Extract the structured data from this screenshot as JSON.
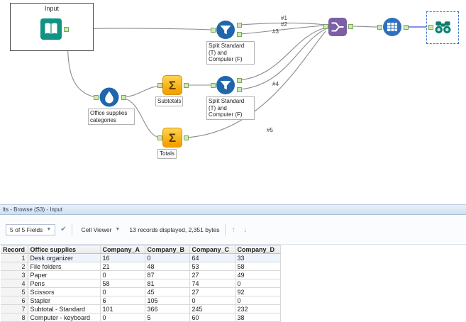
{
  "canvas": {
    "input_container": {
      "label": "Input"
    },
    "tool_labels": {
      "formula": "Office supplies categories",
      "subtotals": "Subtotals",
      "totals": "Totals",
      "filter_top": "Split Standard (T) and Computer (F)",
      "filter_bottom": "Split Standard (T) and Computer (F)"
    },
    "wire_labels": {
      "w1": "#1",
      "w2": "#2",
      "w3": "#3",
      "w4": "#4",
      "w5": "#5"
    },
    "summarize_glyph": "Σ",
    "colors": {
      "input_teal": "#0e9384",
      "tool_blue": "#1f66ad",
      "summarize_orange": "#f5a200",
      "union_purple": "#7d5fa8",
      "anchor_green": "#cdeab3",
      "selection_blue": "#3f74c4"
    }
  },
  "results_panel": {
    "title": "lts - Browse (S3) - Input",
    "toolbar": {
      "fields_dropdown": "5 of 5 Fields",
      "cell_viewer_label": "Cell Viewer",
      "records_info": "13 records displayed, 2,351 bytes"
    },
    "table": {
      "columns": [
        "Record",
        "Office supplies",
        "Company_A",
        "Company_B",
        "Company_C",
        "Company_D"
      ],
      "rows": [
        [
          "1",
          "Desk organizer",
          "16",
          "0",
          "64",
          "33"
        ],
        [
          "2",
          "File folders",
          "21",
          "48",
          "53",
          "58"
        ],
        [
          "3",
          "Paper",
          "0",
          "87",
          "27",
          "49"
        ],
        [
          "4",
          "Pens",
          "58",
          "81",
          "74",
          "0"
        ],
        [
          "5",
          "Scissors",
          "0",
          "45",
          "27",
          "92"
        ],
        [
          "6",
          "Stapler",
          "6",
          "105",
          "0",
          "0"
        ],
        [
          "7",
          "Subtotal - Standard",
          "101",
          "366",
          "245",
          "232"
        ],
        [
          "8",
          "Computer - keyboard",
          "0",
          "5",
          "60",
          "38"
        ]
      ]
    }
  }
}
